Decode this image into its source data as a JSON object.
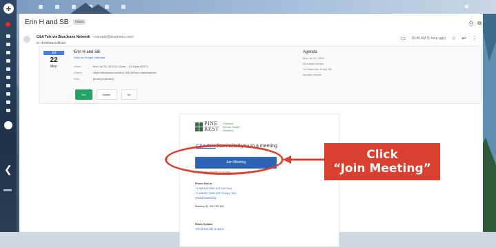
{
  "email": {
    "subject": "Erin H and SB",
    "inbox_label": "Inbox",
    "sender_name": "C&A Tele via BlueJeans Network",
    "sender_email": "<noreply@bluejeans.com>",
    "to_line": "to christina.sullivan",
    "timestamp": "10:45 AM (1 hour ago)"
  },
  "invite": {
    "month": "Jul",
    "day": "22",
    "dow": "Mon",
    "title": "Erin H and SB",
    "calendar_link": "View on Google Calendar",
    "when_label": "When",
    "when_value": "Mon Jul 22, 2019 11:10am – 12:10pm (EDT)",
    "where_label": "Where",
    "where_value": "https://bluejeans.com/941750159?src=calendarLink",
    "who_label": "Who",
    "who_value": "[email protected]",
    "rsvp": [
      "Yes",
      "Maybe",
      "No"
    ]
  },
  "agenda": {
    "title": "Agenda",
    "date": "Mon Jul 22, 2019",
    "items": [
      "No earlier events",
      "11:10am  Erin H and SB",
      "No later events"
    ]
  },
  "body": {
    "logo_word_1": "PINE",
    "logo_word_2": "REST",
    "logo_tag_1": "Christian",
    "logo_tag_2": "Mental Health",
    "logo_tag_3": "Services",
    "invited_link": "C&A Tele",
    "invited_text": " has invited you to a meeting.",
    "join_button": "Join Meeting",
    "join_sub": "(Join from computer or phone)",
    "phone_heading": "Phone Dial-in",
    "phone_1": "+1.888.240.2560 (US Toll Free)",
    "phone_2": "+1.408.317.9253 (US Primary, Toll)",
    "phone_more": "(Global Numbers)",
    "meeting_id": "Meeting ID: 941 750 159",
    "room_heading": "Room System",
    "room_1": "199.48.152.152 or bjn.vc"
  },
  "annotation": {
    "line1": "Click",
    "line2": "“Join Meeting”",
    "color": "#d94030"
  },
  "colors": {
    "rsvp_yes": "#21a464",
    "join_button": "#2d63b3",
    "link": "#1a5fd0"
  }
}
